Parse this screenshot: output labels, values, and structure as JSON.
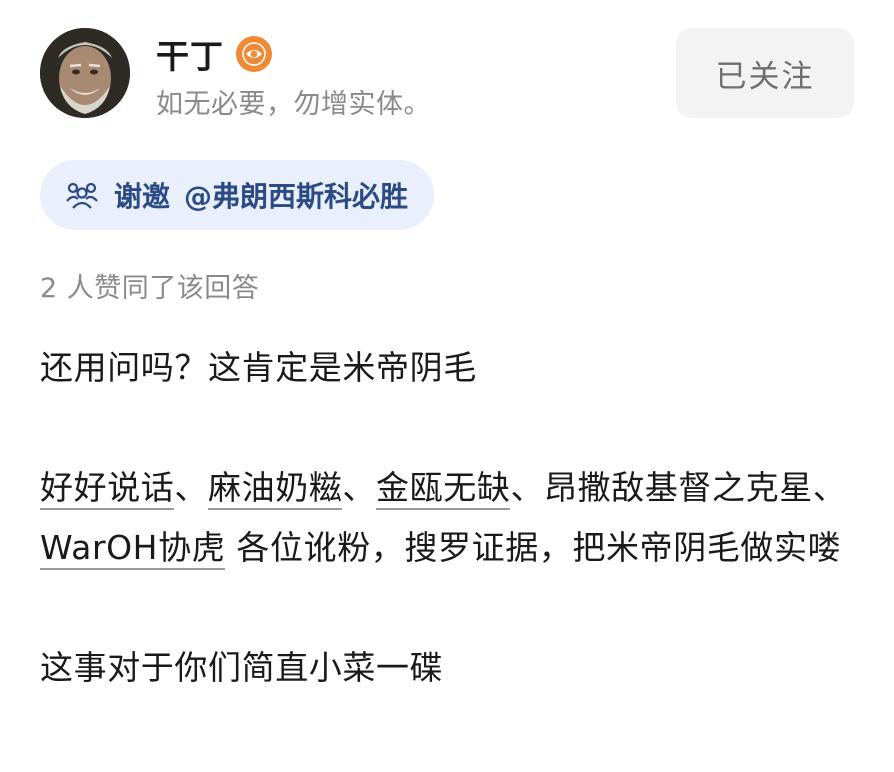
{
  "author": {
    "name": "干丁",
    "bio": "如无必要，勿增实体。",
    "badge_icon": "eye-icon",
    "avatar": "portrait-avatar",
    "follow_label": "已关注"
  },
  "invite": {
    "icon": "invite-people-icon",
    "label": "谢邀",
    "mention": "@弗朗西斯科必胜"
  },
  "votes_text": "2 人赞同了该回答",
  "answer": {
    "p1": "还用问吗？这肯定是米帝阴毛",
    "p2": {
      "link1": "好好说话",
      "sep1": "、",
      "link2": "麻油奶糍",
      "sep2": "、",
      "link3": "金瓯无缺",
      "text1": "、昂撒敌基督之克星、",
      "link4": "WarOH协虎",
      "text2": " 各位讹粉，搜罗证据，把米帝阴毛做实喽"
    },
    "p3": "这事对于你们简直小菜一碟"
  },
  "colors": {
    "invite_bg": "#e9f0fb",
    "invite_text": "#2b4a86",
    "badge": "#f08a35",
    "muted_text": "#8a8a8a",
    "follow_bg": "#f3f3f3"
  }
}
